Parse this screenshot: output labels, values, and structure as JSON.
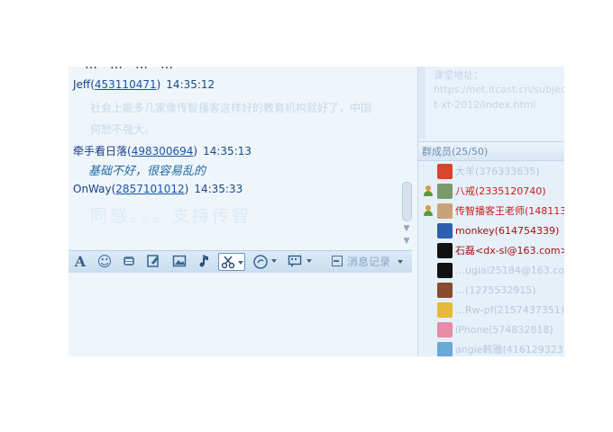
{
  "chat": {
    "cut_line": "…………",
    "messages": [
      {
        "sender": "Jeff",
        "qq": "453110471",
        "time": "14:35:12",
        "lines": [
          "社会上能多几家像传智播客这样好的教育机构就好了，中国",
          "何愁不强大。"
        ]
      },
      {
        "sender": "牵手看日落",
        "qq": "498300694",
        "time": "14:35:13",
        "lines": [
          "基础不好，很容易乱的"
        ]
      },
      {
        "sender": "OnWay",
        "qq": "2857101012",
        "time": "14:35:33",
        "lines": [
          "同感。。。支持传智"
        ]
      }
    ]
  },
  "toolbar": {
    "font_icon": "A",
    "emoji_icon": "☺",
    "history_label": "消息记录"
  },
  "right_panel": {
    "announcement_lines": [
      "课堂地址：",
      "https://net.itcast.cn/subjec",
      "t-xt-2012/index.html"
    ],
    "members_title": "群成员(25/50)",
    "members": [
      {
        "name": "大羊(376333635)",
        "style": "dim",
        "role": false,
        "avatar_color": "#d8452e"
      },
      {
        "name": "八戒(2335120740)",
        "style": "active",
        "role": true,
        "avatar_color": "#7b9a6b"
      },
      {
        "name": "传智播客王老师(148113",
        "style": "active",
        "role": true,
        "avatar_color": "#c9a27a"
      },
      {
        "name": "monkey(614754339)",
        "style": "dark",
        "role": false,
        "avatar_color": "#2d5fb0"
      },
      {
        "name": "石磊<dx-sl@163.com>",
        "style": "dark",
        "role": false,
        "avatar_color": "#111111"
      },
      {
        "name": "…ugiai25184@163.com",
        "style": "dim",
        "role": false,
        "avatar_color": "#111111"
      },
      {
        "name": "…(1275532915)",
        "style": "dim",
        "role": false,
        "avatar_color": "#8a4a2c"
      },
      {
        "name": "…Rw-pf(2157437351)",
        "style": "dim",
        "role": false,
        "avatar_color": "#e8b83a"
      },
      {
        "name": "iPhone(574832818)",
        "style": "dim",
        "role": false,
        "avatar_color": "#e88aa8"
      },
      {
        "name": "angie韩雅(416129323)",
        "style": "dim",
        "role": false,
        "avatar_color": "#6aa9d8"
      }
    ]
  }
}
